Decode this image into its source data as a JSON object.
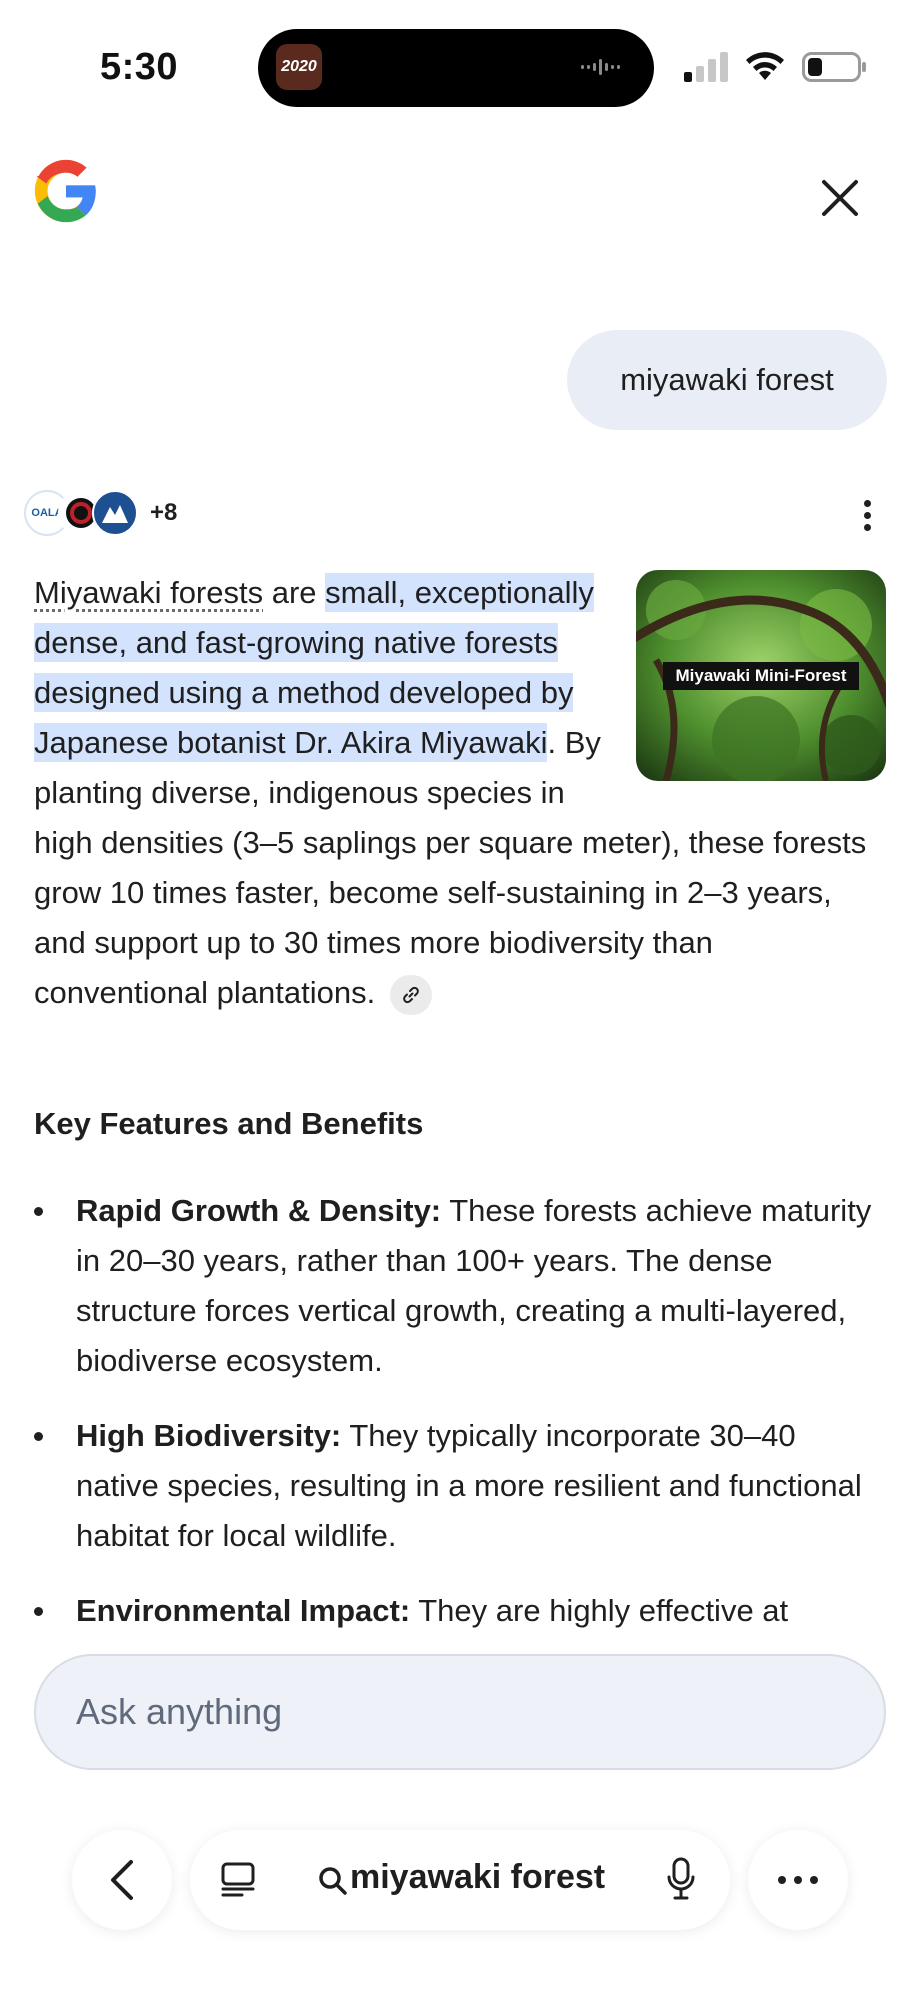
{
  "status": {
    "time": "5:30",
    "island_app_label": "2020"
  },
  "header": {
    "logo": "google-g-logo",
    "close_icon": "close-icon"
  },
  "query": {
    "text": "miyawaki forest"
  },
  "sources": {
    "logos": [
      "OALA",
      "",
      ""
    ],
    "more_count": "+8"
  },
  "thumbnail": {
    "caption": "Miyawaki Mini-Forest"
  },
  "answer": {
    "term": "Miyawaki forests",
    "are": " are ",
    "highlight": "small, exceptionally dense, and fast-growing native forests designed using a method developed by Japanese botanist Dr. Akira Miyawaki",
    "rest": ". By planting diverse, indigenous species in high densities (3–5 saplings per square meter), these forests grow 10 times faster, become self-sustaining in 2–3 years, and support up to 30 times more biodiversity than conventional plantations."
  },
  "section": {
    "title": "Key Features and Benefits"
  },
  "bullets": [
    {
      "label": "Rapid Growth & Density:",
      "text": " These forests achieve maturity in 20–30 years, rather than 100+ years. The dense structure forces vertical growth, creating a multi-layered, biodiverse ecosystem."
    },
    {
      "label": "High Biodiversity:",
      "text": " They typically incorporate 30–40 native species, resulting in a more resilient and functional habitat for local wildlife."
    },
    {
      "label": "Environmental Impact:",
      "text": " They are highly effective at"
    }
  ],
  "ask": {
    "placeholder": "Ask anything"
  },
  "bottom_bar": {
    "search_text": "miyawaki forest"
  },
  "colors": {
    "highlight": "#d3e3fd",
    "bubble": "#e9eef6",
    "ask_bar": "#eef1f7"
  }
}
